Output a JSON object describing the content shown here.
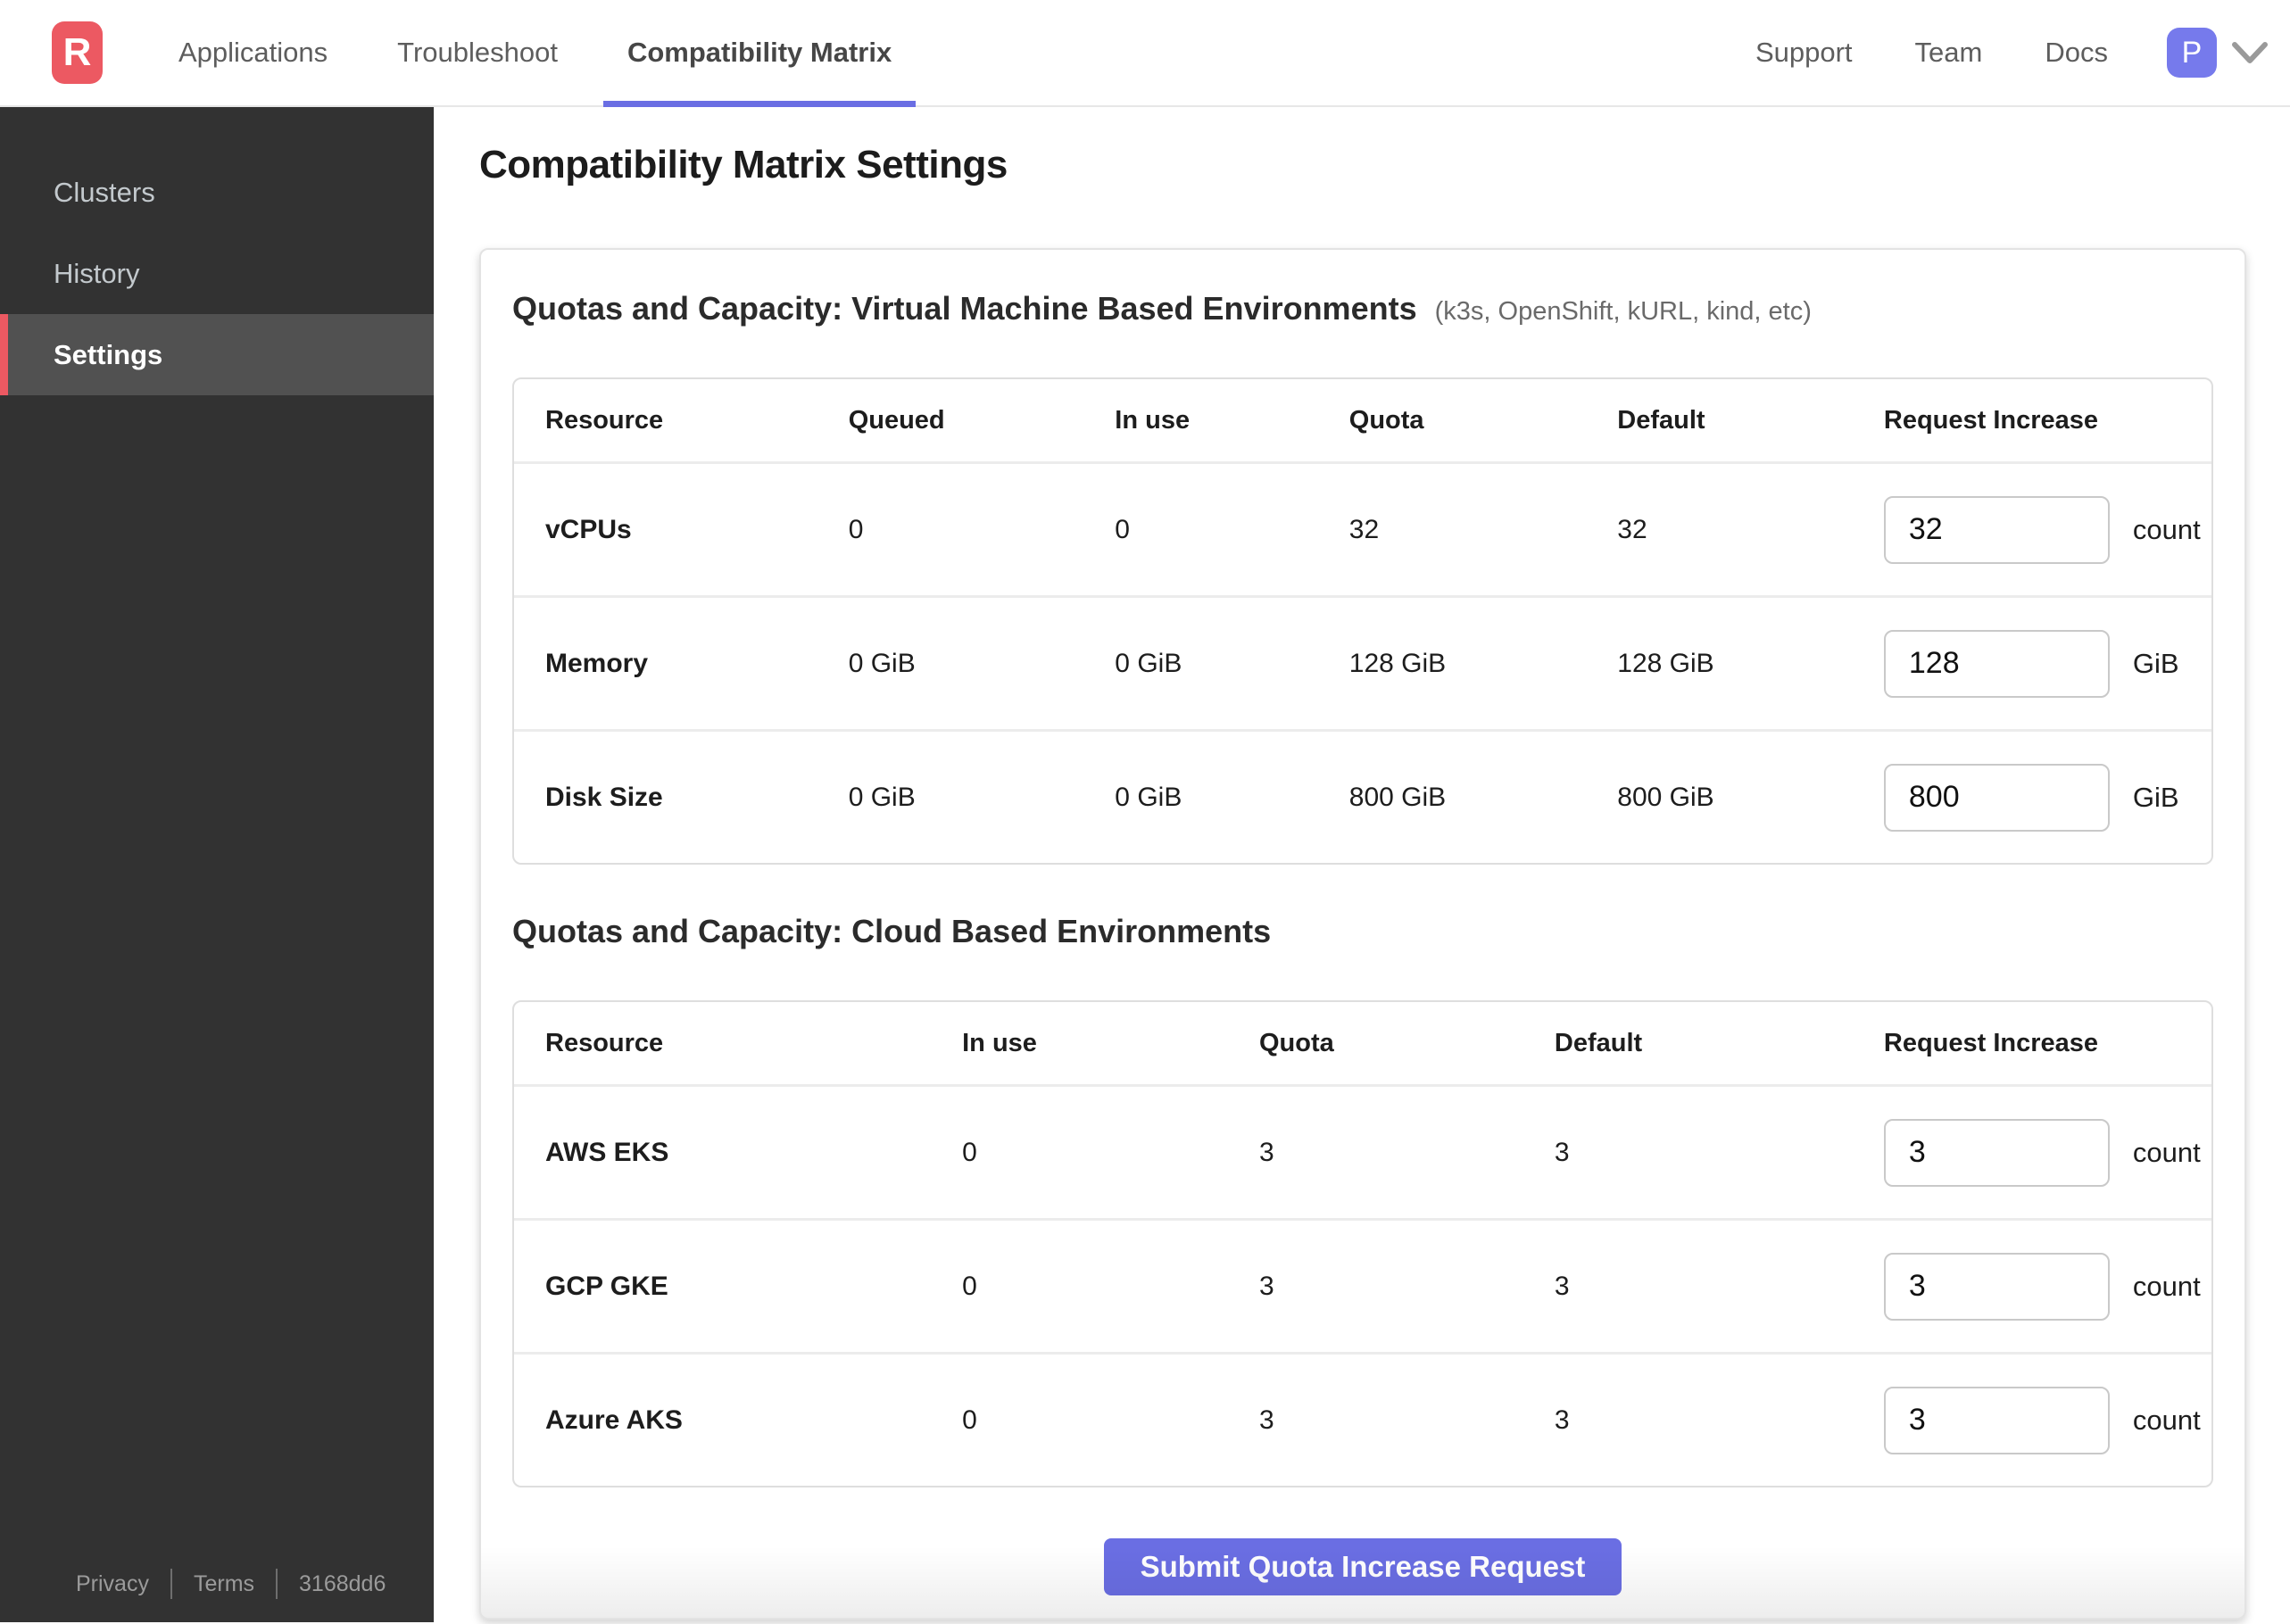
{
  "nav": {
    "logo_letter": "R",
    "tabs": [
      {
        "label": "Applications",
        "active": false
      },
      {
        "label": "Troubleshoot",
        "active": false
      },
      {
        "label": "Compatibility Matrix",
        "active": true
      }
    ],
    "links": [
      "Support",
      "Team",
      "Docs"
    ],
    "avatar_initial": "P"
  },
  "sidebar": {
    "items": [
      {
        "label": "Clusters",
        "active": false
      },
      {
        "label": "History",
        "active": false
      },
      {
        "label": "Settings",
        "active": true
      }
    ],
    "footer": {
      "privacy": "Privacy",
      "terms": "Terms",
      "build": "3168dd6"
    }
  },
  "page": {
    "title": "Compatibility Matrix Settings"
  },
  "sections": [
    {
      "title": "Quotas and Capacity: Virtual Machine Based Environments",
      "subtitle": "(k3s, OpenShift, kURL, kind, etc)",
      "columns": [
        "Resource",
        "Queued",
        "In use",
        "Quota",
        "Default",
        "Request Increase"
      ],
      "rows": [
        {
          "resource": "vCPUs",
          "queued": "0",
          "in_use": "0",
          "quota": "32",
          "default": "32",
          "input_value": "32",
          "unit": "count"
        },
        {
          "resource": "Memory",
          "queued": "0 GiB",
          "in_use": "0 GiB",
          "quota": "128 GiB",
          "default": "128 GiB",
          "input_value": "128",
          "unit": "GiB"
        },
        {
          "resource": "Disk Size",
          "queued": "0 GiB",
          "in_use": "0 GiB",
          "quota": "800 GiB",
          "default": "800 GiB",
          "input_value": "800",
          "unit": "GiB"
        }
      ]
    },
    {
      "title": "Quotas and Capacity: Cloud Based Environments",
      "columns": [
        "Resource",
        "In use",
        "Quota",
        "Default",
        "Request Increase"
      ],
      "rows": [
        {
          "resource": "AWS EKS",
          "in_use": "0",
          "quota": "3",
          "default": "3",
          "input_value": "3",
          "unit": "count"
        },
        {
          "resource": "GCP GKE",
          "in_use": "0",
          "quota": "3",
          "default": "3",
          "input_value": "3",
          "unit": "count"
        },
        {
          "resource": "Azure AKS",
          "in_use": "0",
          "quota": "3",
          "default": "3",
          "input_value": "3",
          "unit": "count"
        }
      ]
    }
  ],
  "submit_button": "Submit Quota Increase Request",
  "colors": {
    "brand_red": "#ec5962",
    "accent_indigo": "#6a6ee3",
    "avatar_indigo": "#767aec",
    "sidebar_bg": "#323232",
    "sidebar_active_bg": "#515151"
  }
}
